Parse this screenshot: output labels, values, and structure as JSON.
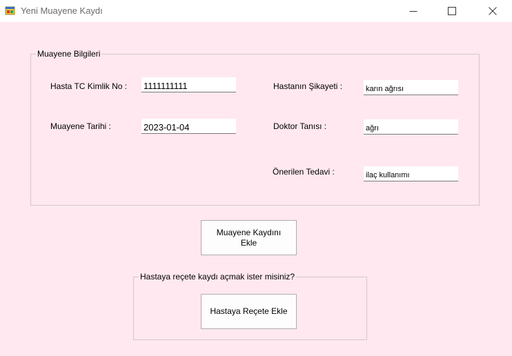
{
  "window": {
    "title": "Yeni Muayene Kaydı"
  },
  "groups": {
    "exam": {
      "legend": "Muayene Bilgileri",
      "tc_label": "Hasta TC Kimlik No :",
      "tc_value": "1111111111",
      "date_label": "Muayene Tarihi :",
      "date_value": "2023-01-04",
      "complaint_label": "Hastanın Şikayeti :",
      "complaint_value": "karın ağrısı",
      "diagnosis_label": "Doktor Tanısı :",
      "diagnosis_value": "ağrı",
      "treatment_label": "Önerilen Tedavi :",
      "treatment_value": "ilaç kullanımı"
    },
    "prescription": {
      "legend": "Hastaya reçete kaydı açmak ister misiniz?"
    }
  },
  "buttons": {
    "add_exam": "Muayene Kaydını Ekle",
    "add_prescription": "Hastaya Reçete Ekle"
  }
}
